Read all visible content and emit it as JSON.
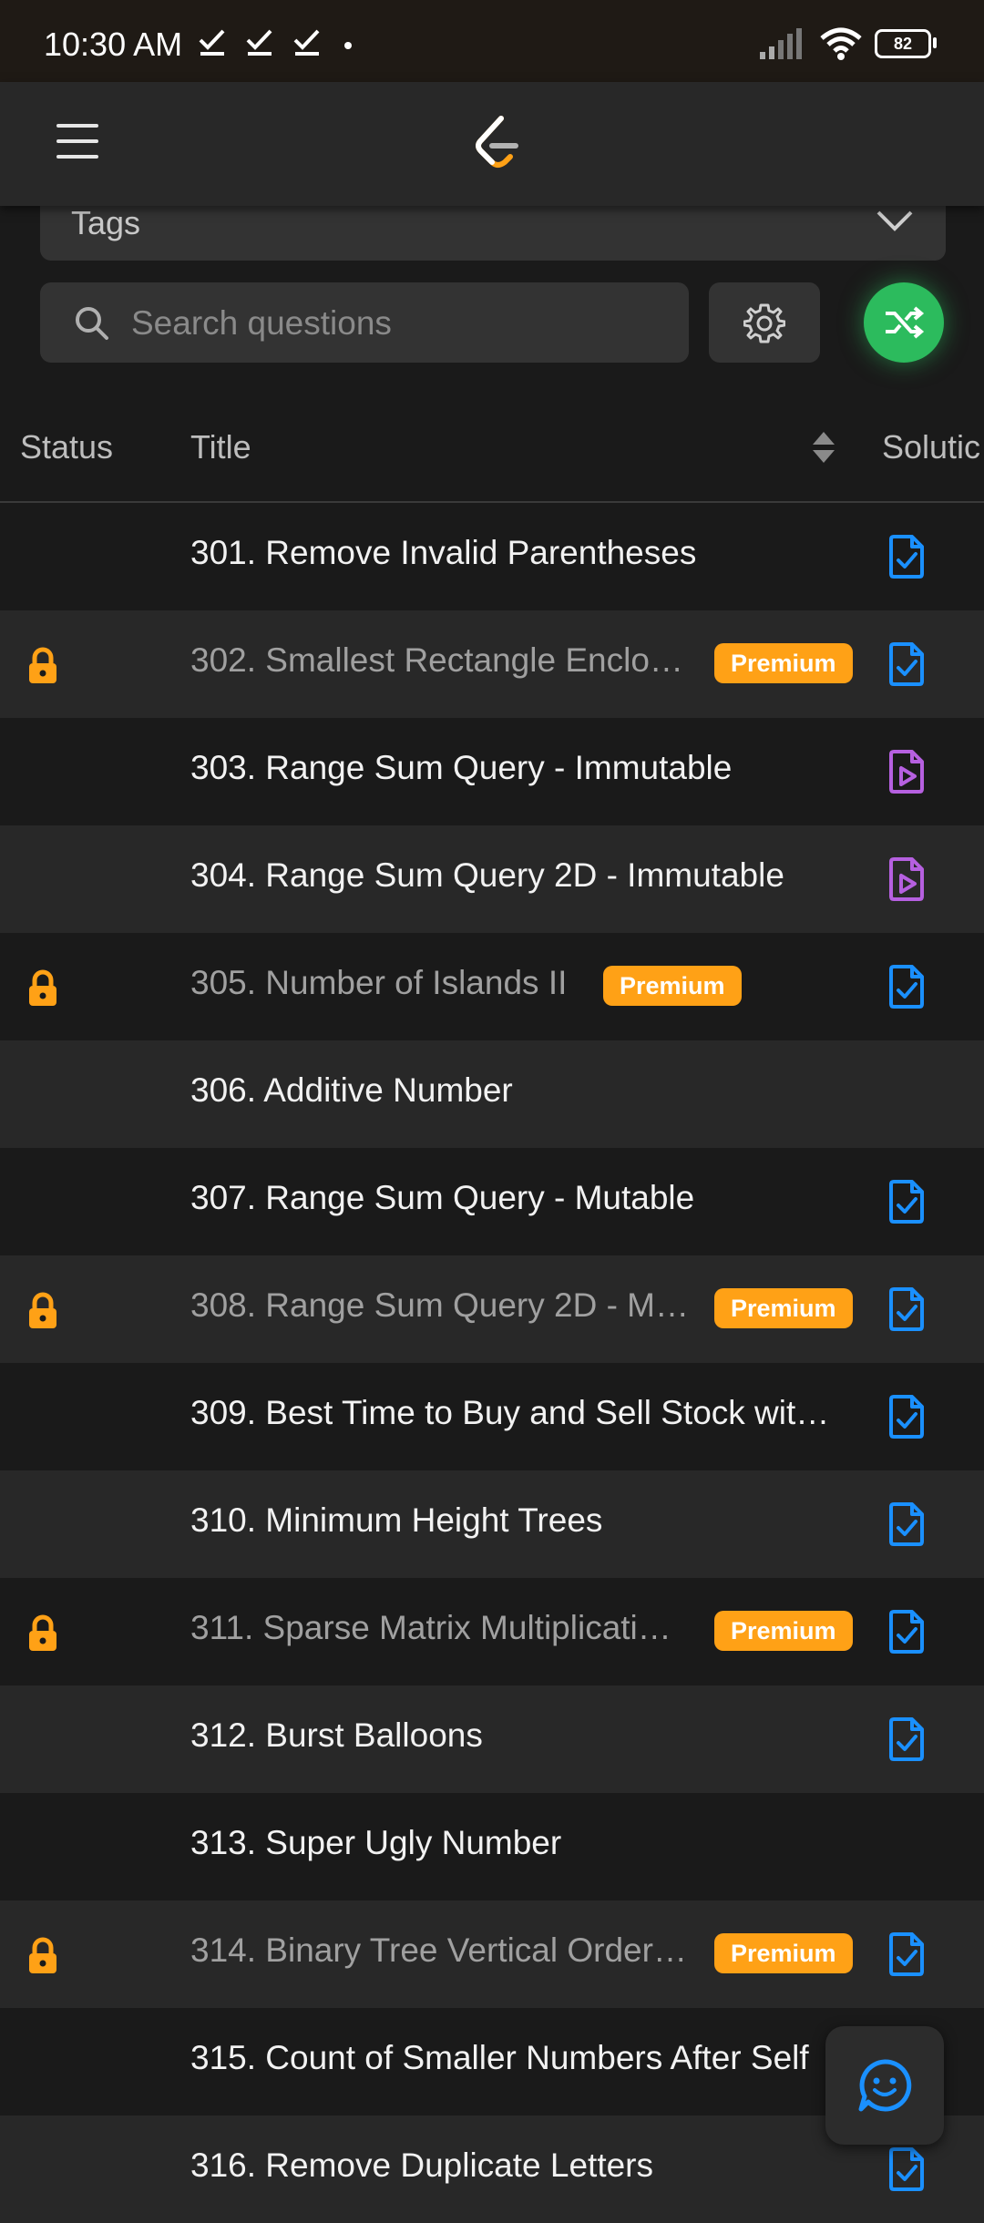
{
  "status_bar": {
    "time": "10:30 AM",
    "battery": "82"
  },
  "filters": {
    "tags_label": "Tags"
  },
  "search": {
    "placeholder": "Search questions"
  },
  "table": {
    "headers": {
      "status": "Status",
      "title": "Title",
      "solution": "Solutic"
    },
    "badge_label": "Premium",
    "rows": [
      {
        "title": "301. Remove Invalid Parentheses",
        "locked": false,
        "premium": false,
        "solution": "article"
      },
      {
        "title": "302. Smallest Rectangle Enclo…",
        "locked": true,
        "premium": true,
        "solution": "article"
      },
      {
        "title": "303. Range Sum Query - Immutable",
        "locked": false,
        "premium": false,
        "solution": "video"
      },
      {
        "title": "304. Range Sum Query 2D - Immutable",
        "locked": false,
        "premium": false,
        "solution": "video"
      },
      {
        "title": "305. Number of Islands II",
        "locked": true,
        "premium": true,
        "solution": "article"
      },
      {
        "title": "306. Additive Number",
        "locked": false,
        "premium": false,
        "solution": "none"
      },
      {
        "title": "307. Range Sum Query - Mutable",
        "locked": false,
        "premium": false,
        "solution": "article"
      },
      {
        "title": "308. Range Sum Query 2D - M…",
        "locked": true,
        "premium": true,
        "solution": "article"
      },
      {
        "title": "309. Best Time to Buy and Sell Stock wit…",
        "locked": false,
        "premium": false,
        "solution": "article"
      },
      {
        "title": "310. Minimum Height Trees",
        "locked": false,
        "premium": false,
        "solution": "article"
      },
      {
        "title": "311. Sparse Matrix Multiplicati…",
        "locked": true,
        "premium": true,
        "solution": "article"
      },
      {
        "title": "312. Burst Balloons",
        "locked": false,
        "premium": false,
        "solution": "article"
      },
      {
        "title": "313. Super Ugly Number",
        "locked": false,
        "premium": false,
        "solution": "none"
      },
      {
        "title": "314. Binary Tree Vertical Order…",
        "locked": true,
        "premium": true,
        "solution": "article"
      },
      {
        "title": "315. Count of Smaller Numbers After Self",
        "locked": false,
        "premium": false,
        "solution": "none"
      },
      {
        "title": "316. Remove Duplicate Letters",
        "locked": false,
        "premium": false,
        "solution": "article"
      }
    ]
  },
  "colors": {
    "background": "#1a1a1a",
    "row_alt": "#282828",
    "premium": "#ffa116",
    "lock": "#ffa116",
    "article_icon": "#1a90ff",
    "video_icon": "#b660e0",
    "shuffle": "#2cbb5d"
  },
  "icons": {
    "menu": "hamburger-menu-icon",
    "logo": "leetcode-logo",
    "search": "search-icon",
    "settings": "gear-icon",
    "shuffle": "shuffle-icon",
    "lock": "lock-icon",
    "article": "check-document-icon",
    "video": "play-document-icon",
    "feedback": "smiley-chat-icon"
  }
}
